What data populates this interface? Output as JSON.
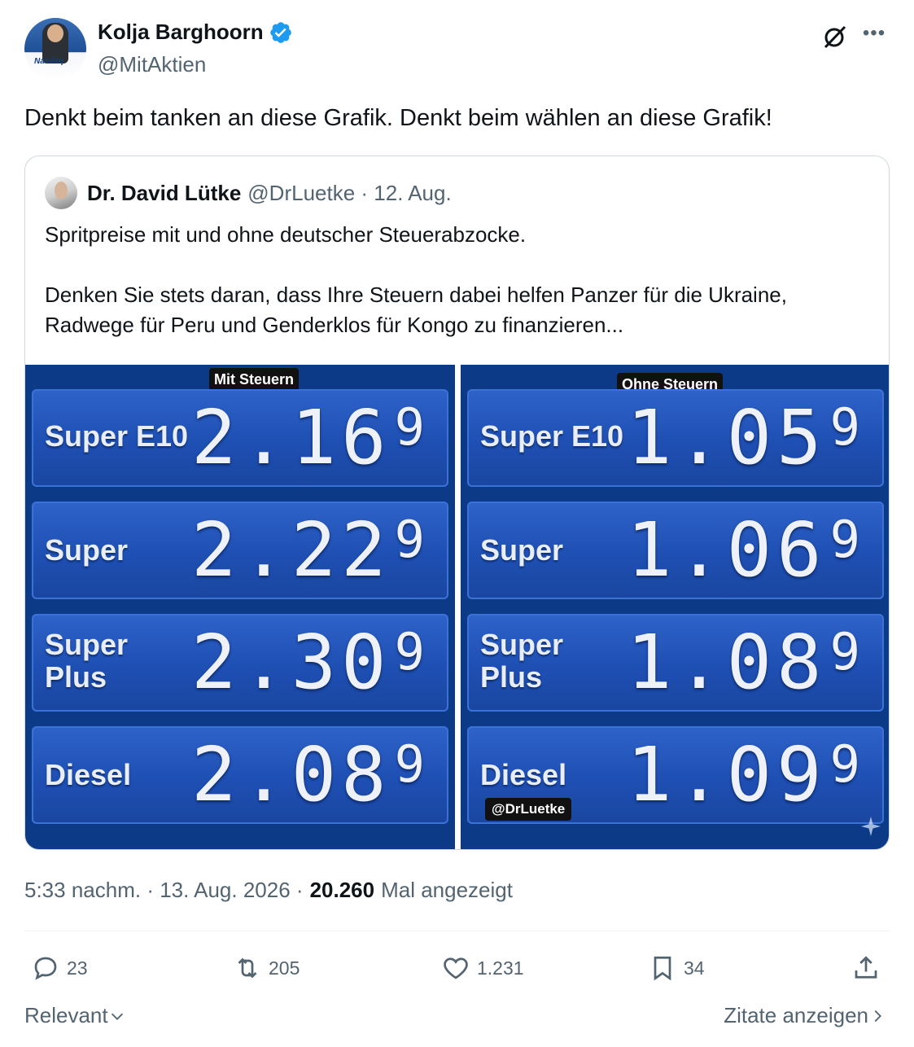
{
  "author": {
    "name": "Kolja Barghoorn",
    "handle": "@MitAktien",
    "avatar_badge": "Nasdaq"
  },
  "tweet": {
    "text": "Denkt beim tanken an diese Grafik. Denkt beim wählen an diese Grafik!"
  },
  "quote": {
    "name": "Dr. David Lütke",
    "handle": "@DrLuetke · 12. Aug.",
    "text": "Spritpreise mit und ohne deutscher Steuerabzocke.\n\nDenken Sie stets daran, dass Ihre Steuern dabei helfen Panzer für die Ukraine, Radwege für Peru und Genderklos für Kongo zu finanzieren...",
    "media": {
      "left": {
        "label": "Mit Steuern",
        "rows": [
          {
            "name": "Super E10",
            "price": "2.16",
            "tenth": "9"
          },
          {
            "name": "Super",
            "price": "2.22",
            "tenth": "9"
          },
          {
            "name": "Super Plus",
            "price": "2.30",
            "tenth": "9"
          },
          {
            "name": "Diesel",
            "price": "2.08",
            "tenth": "9"
          }
        ]
      },
      "right": {
        "label": "Ohne Steuern",
        "watermark": "@DrLuetke",
        "rows": [
          {
            "name": "Super E10",
            "price": "1.05",
            "tenth": "9"
          },
          {
            "name": "Super",
            "price": "1.06",
            "tenth": "9"
          },
          {
            "name": "Super Plus",
            "price": "1.08",
            "tenth": "9"
          },
          {
            "name": "Diesel",
            "price": "1.09",
            "tenth": "9"
          }
        ]
      }
    }
  },
  "meta": {
    "time": "5:33 nachm. · 13. Aug. 2026 ·",
    "views": "20.260",
    "views_label": "Mal angezeigt"
  },
  "actions": {
    "replies": "23",
    "reposts": "205",
    "likes": "1.231",
    "bookmarks": "34"
  },
  "footer": {
    "sort_label": "Relevant",
    "quotes_link": "Zitate anzeigen"
  },
  "colors": {
    "verified": "#1d9bf0",
    "secondary_text": "#536471",
    "panel_blue": "#1e4fb3"
  }
}
